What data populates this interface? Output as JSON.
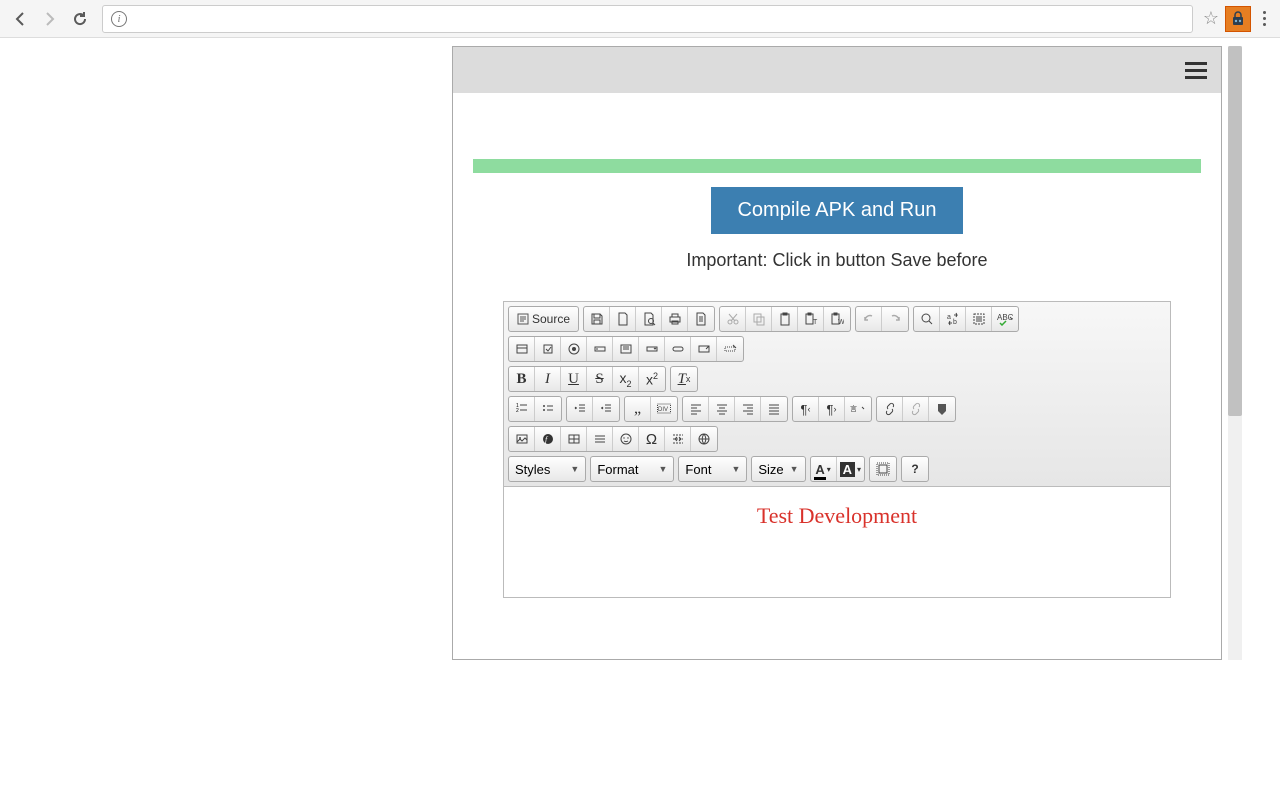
{
  "browser": {
    "url": ""
  },
  "header": {},
  "main": {
    "compile_label": "Compile APK and Run",
    "important_text": "Important: Click in button Save before"
  },
  "editor": {
    "source_label": "Source",
    "styles_label": "Styles",
    "format_label": "Format",
    "font_label": "Font",
    "size_label": "Size",
    "help_label": "?",
    "content_text": "Test Development"
  }
}
